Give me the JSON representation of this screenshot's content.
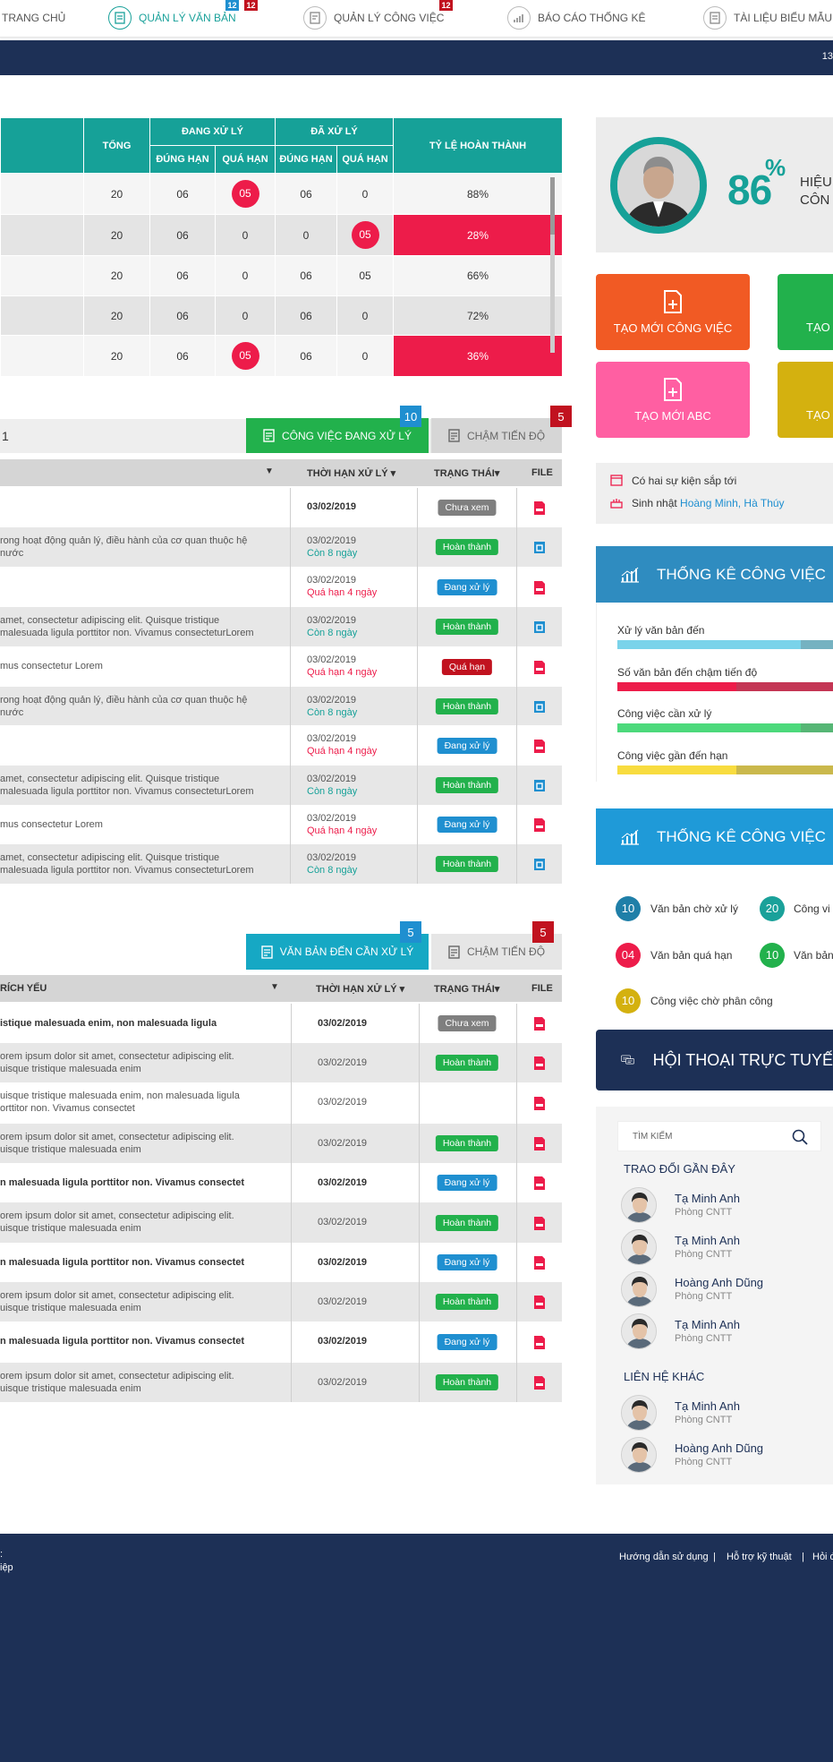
{
  "nav": {
    "items": [
      {
        "label": "TRANG CHỦ"
      },
      {
        "label": "QUẢN LÝ VĂN BẢN",
        "badge1": "12",
        "badge2": "12"
      },
      {
        "label": "QUẢN LÝ CÔNG VIỆC",
        "badge1": "12"
      },
      {
        "label": "BÁO CÁO THỐNG KÊ"
      },
      {
        "label": "TÀI LIỆU BIỂU MẪU"
      }
    ]
  },
  "band": {
    "right_num": "13"
  },
  "stats": {
    "headers": {
      "tong": "TỔNG",
      "dang_xu_ly": "ĐANG XỬ LÝ",
      "da_xu_ly": "ĐÃ XỬ LÝ",
      "dung_han": "ĐÚNG HẠN",
      "qua_han": "QUÁ HẠN",
      "ty_le": "TỶ LỆ HOÀN THÀNH"
    },
    "rows": [
      {
        "tong": "20",
        "d1": "06",
        "q1": "05",
        "d2": "06",
        "q2": "0",
        "pct": "88%"
      },
      {
        "tong": "20",
        "d1": "06",
        "q1": "0",
        "d2": "0",
        "q2": "05",
        "pct": "28%"
      },
      {
        "tong": "20",
        "d1": "06",
        "q1": "0",
        "d2": "06",
        "q2": "05",
        "pct": "66%"
      },
      {
        "tong": "20",
        "d1": "06",
        "q1": "0",
        "d2": "06",
        "q2": "0",
        "pct": "72%"
      },
      {
        "tong": "20",
        "d1": "06",
        "q1": "05",
        "d2": "06",
        "q2": "0",
        "pct": "36%"
      }
    ]
  },
  "profile": {
    "percent": "86",
    "percent_sign": "%",
    "line1": "HIỆU",
    "line2": "CÔN"
  },
  "tiles": [
    {
      "label": "TẠO MỚI CÔNG VIỆC",
      "color": "#f15a24"
    },
    {
      "label": "TẠO",
      "color": "#22b14c"
    },
    {
      "label": "TẠO MỚI ABC",
      "color": "#ff5fa2"
    },
    {
      "label": "TẠO",
      "color": "#d4b10f"
    }
  ],
  "section1": {
    "left_label": "1",
    "tab_active": "CÔNG VIỆC ĐANG  XỬ LÝ",
    "tab_active_badge": "10",
    "tab_other": "CHẬM TIẾN ĐỘ",
    "tab_other_badge": "5",
    "col_deadline": "THỜI HẠN XỬ LÝ",
    "col_status": "TRẠNG THÁI",
    "col_file": "FILE",
    "rows": [
      {
        "desc": "",
        "date": "03/02/2019",
        "sub": "",
        "status": "Chưa xem",
        "file": "pdf"
      },
      {
        "desc": "rong hoạt động quản lý, điều hành của cơ quan thuộc hệ\n nước",
        "date": "03/02/2019",
        "sub": "Còn 8 ngày",
        "status": "Hoàn thành",
        "file": "doc"
      },
      {
        "desc": "",
        "date": "03/02/2019",
        "sub": "Quá hạn 4 ngày",
        "status": "Đang xử lý",
        "file": "pdf"
      },
      {
        "desc": "amet, consectetur adipiscing elit. Quisque tristique\nmalesuada ligula porttitor non. Vivamus consecteturLorem",
        "date": "03/02/2019",
        "sub": "Còn 8 ngày",
        "status": "Hoàn thành",
        "file": "doc"
      },
      {
        "desc": "mus consectetur Lorem",
        "date": "03/02/2019",
        "sub": "Quá hạn 4 ngày",
        "status": "Quá hạn",
        "file": "pdf"
      },
      {
        "desc": "rong hoạt động quản lý, điều hành của cơ quan thuộc hệ\n nước",
        "date": "03/02/2019",
        "sub": "Còn 8 ngày",
        "status": "Hoàn thành",
        "file": "doc"
      },
      {
        "desc": "",
        "date": "03/02/2019",
        "sub": "Quá hạn 4 ngày",
        "status": "Đang xử lý",
        "file": "pdf"
      },
      {
        "desc": "amet, consectetur adipiscing elit. Quisque tristique\nmalesuada ligula porttitor non. Vivamus consecteturLorem",
        "date": "03/02/2019",
        "sub": "Còn 8 ngày",
        "status": "Hoàn thành",
        "file": "doc"
      },
      {
        "desc": "mus consectetur Lorem",
        "date": "03/02/2019",
        "sub": "Quá hạn 4 ngày",
        "status": "Đang xử lý",
        "file": "pdf"
      },
      {
        "desc": "amet, consectetur adipiscing elit. Quisque tristique\nmalesuada ligula porttitor non. Vivamus consecteturLorem",
        "date": "03/02/2019",
        "sub": "Còn 8 ngày",
        "status": "Hoàn thành",
        "file": "doc"
      }
    ]
  },
  "section2": {
    "tab_active": "VĂN BẢN ĐẾN CẦN XỬ LÝ",
    "tab_active_badge": "5",
    "tab_other": "CHẬM TIẾN ĐỘ",
    "tab_other_badge": "5",
    "col_summary": "RÍCH YẾU",
    "col_deadline": "THỜI HẠN XỬ LÝ",
    "col_status": "TRẠNG THÁI",
    "col_file": "FILE",
    "rows": [
      {
        "desc": "istique malesuada enim, non malesuada ligula",
        "date": "03/02/2019",
        "status": "Chưa xem",
        "bold": true
      },
      {
        "desc": "orem ipsum dolor sit amet, consectetur adipiscing elit.\nuisque tristique malesuada enim",
        "date": "03/02/2019",
        "status": "Hoàn thành",
        "bold": false
      },
      {
        "desc": "uisque tristique malesuada enim, non malesuada ligula\norttitor non. Vivamus consectet",
        "date": "03/02/2019",
        "status": "",
        "bold": false
      },
      {
        "desc": "orem ipsum dolor sit amet, consectetur adipiscing elit.\nuisque tristique malesuada enim",
        "date": "03/02/2019",
        "status": "Hoàn thành",
        "bold": false
      },
      {
        "desc": "n malesuada ligula porttitor non. Vivamus consectet",
        "date": "03/02/2019",
        "status": "Đang xử lý",
        "bold": true
      },
      {
        "desc": "orem ipsum dolor sit amet, consectetur adipiscing elit.\nuisque tristique malesuada enim",
        "date": "03/02/2019",
        "status": "Hoàn thành",
        "bold": false
      },
      {
        "desc": "n malesuada ligula porttitor non. Vivamus consectet",
        "date": "03/02/2019",
        "status": "Đang xử lý",
        "bold": true
      },
      {
        "desc": "orem ipsum dolor sit amet, consectetur adipiscing elit.\nuisque tristique malesuada enim",
        "date": "03/02/2019",
        "status": "Hoàn thành",
        "bold": false
      },
      {
        "desc": "n malesuada ligula porttitor non. Vivamus consectet",
        "date": "03/02/2019",
        "status": "Đang xử lý",
        "bold": true
      },
      {
        "desc": "orem ipsum dolor sit amet, consectetur adipiscing elit.\nuisque tristique malesuada enim",
        "date": "03/02/2019",
        "status": "Hoàn thành",
        "bold": false
      }
    ]
  },
  "status_colors": {
    "Chưa xem": "#7f7f7f",
    "Hoàn thành": "#22b14c",
    "Đang xử lý": "#1f8fd0",
    "Quá hạn": "#c1121f"
  },
  "events": {
    "line1": "Có hai sự kiện sắp tới",
    "line2_prefix": "Sinh nhật ",
    "line2_names": "Hoàng Minh, Hà Thúy"
  },
  "work_stats1": {
    "title": "THỐNG KÊ CÔNG VIỆC",
    "bars": [
      {
        "label": "Xử lý văn bản đến",
        "color": "#7ad3ea",
        "fill": 0.85
      },
      {
        "label": "Số văn bản đến chậm tiến độ",
        "color": "#ed1c4a",
        "fill": 0.55
      },
      {
        "label": "Công việc cần xử lý",
        "color": "#4cd97b",
        "fill": 0.85
      },
      {
        "label": "Công việc gần đến hạn",
        "color": "#f8dc3f",
        "fill": 0.55
      }
    ]
  },
  "work_stats2": {
    "title": "THỐNG KÊ CÔNG VIỆC",
    "items": [
      {
        "num": "10",
        "label": "Văn bản chờ xử lý",
        "color": "#1f7fa8"
      },
      {
        "num": "20",
        "label": "Công vi",
        "color": "#1aa19a"
      },
      {
        "num": "04",
        "label": "Văn bản quá hạn",
        "color": "#ed1c4a"
      },
      {
        "num": "10",
        "label": "Văn bản",
        "color": "#22b14c"
      },
      {
        "num": "10",
        "label": "Công việc chờ phân công",
        "color": "#d4b10f"
      }
    ]
  },
  "chat": {
    "title": "HỘI THOẠI TRỰC TUYẾ",
    "search_placeholder": "TÌM KIẾM",
    "recent_label": "TRAO ĐỔI GẦN ĐÂY",
    "recent": [
      {
        "name": "Tạ Minh Anh",
        "dept": "Phòng CNTT"
      },
      {
        "name": "Tạ Minh Anh",
        "dept": "Phòng CNTT"
      },
      {
        "name": "Hoàng Anh Dũng",
        "dept": "Phòng CNTT"
      },
      {
        "name": "Tạ Minh Anh",
        "dept": "Phòng CNTT"
      }
    ],
    "other_label": "LIÊN HỆ KHÁC",
    "others": [
      {
        "name": "Tạ Minh Anh",
        "dept": "Phòng CNTT"
      },
      {
        "name": "Hoàng Anh Dũng",
        "dept": "Phòng CNTT"
      }
    ]
  },
  "footer": {
    "left1": ":",
    "left2": "iệp",
    "links": [
      "Hướng dẫn sử dụng",
      "Hỗ trợ kỹ thuật",
      "Hỏi đ"
    ],
    "sep": "|"
  }
}
